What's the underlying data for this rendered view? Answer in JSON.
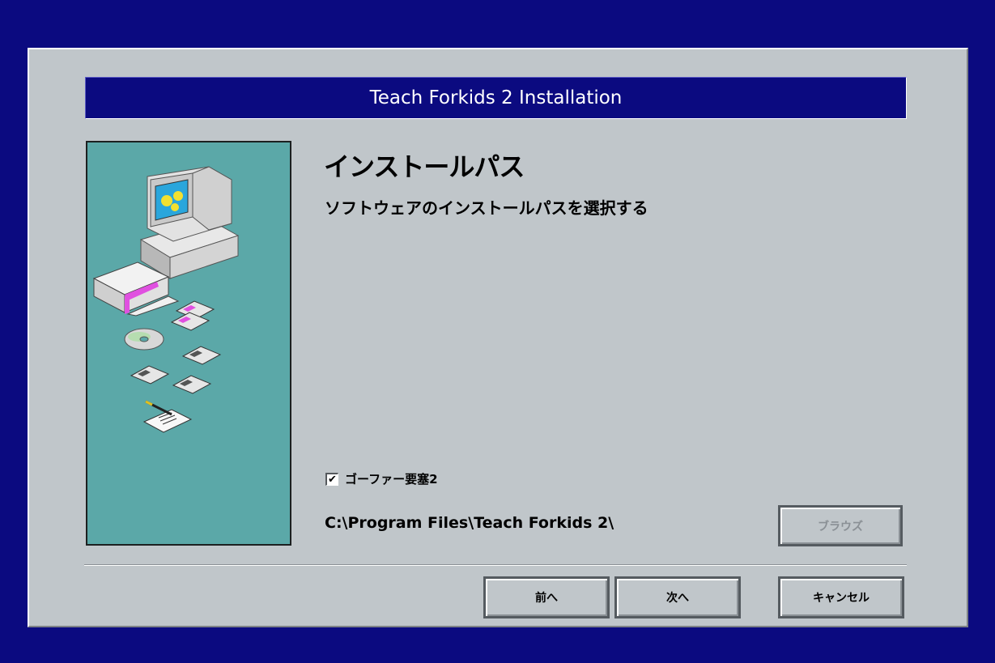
{
  "window": {
    "title": "Teach Forkids 2 Installation"
  },
  "main": {
    "heading": "インストールパス",
    "subheading": "ソフトウェアのインストールパスを選択する"
  },
  "option": {
    "checkbox_checked": true,
    "checkbox_mark": "✔",
    "checkbox_label": "ゴーファー要塞2"
  },
  "install": {
    "path": "C:\\Program Files\\Teach Forkids 2\\",
    "browse_label": "ブラウズ",
    "browse_enabled": false
  },
  "footer": {
    "back_label": "前へ",
    "next_label": "次へ",
    "cancel_label": "キャンセル"
  },
  "colors": {
    "desktop": "#0b0a80",
    "dialog": "#c0c6ca",
    "panel": "#5ba8a8",
    "accent": "#e050e0"
  },
  "icons": [
    "computer-icon",
    "software-box-icon",
    "floppy-disk-icon",
    "cd-rom-icon",
    "pen-and-paper-icon"
  ]
}
